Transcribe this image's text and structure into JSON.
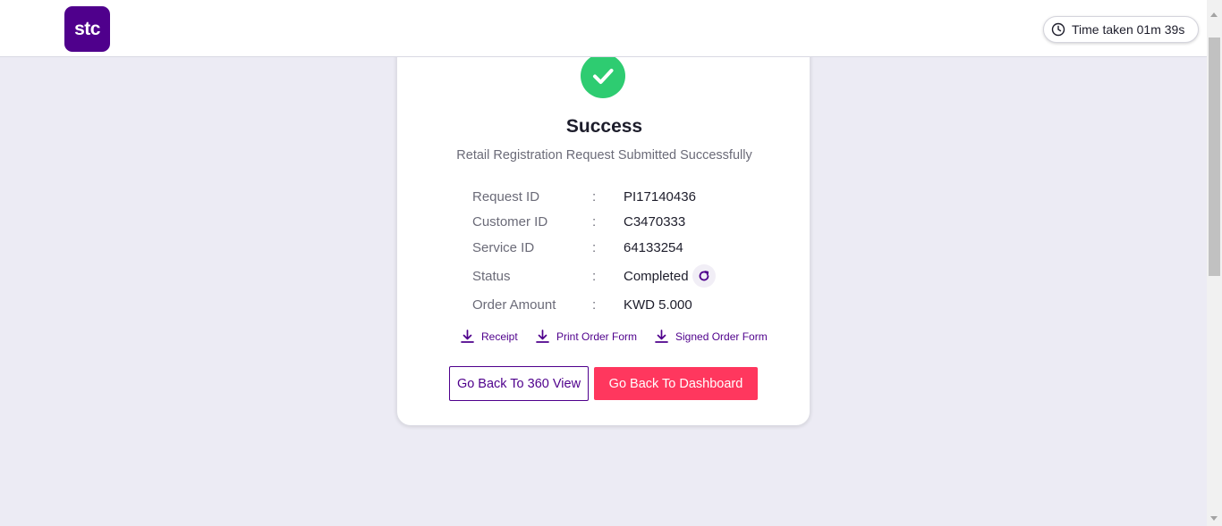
{
  "header": {
    "logo_text": "stc",
    "timer_label": "Time taken 01m 39s"
  },
  "card": {
    "title": "Success",
    "subtitle": "Retail Registration Request Submitted Successfully",
    "details": [
      {
        "label": "Request ID",
        "separator": ":",
        "value": "PI17140436"
      },
      {
        "label": "Customer ID",
        "separator": ":",
        "value": "C3470333"
      },
      {
        "label": "Service ID",
        "separator": ":",
        "value": "64133254"
      },
      {
        "label": "Status",
        "separator": ":",
        "value": "Completed"
      },
      {
        "label": "Order Amount",
        "separator": ":",
        "value": "KWD 5.000"
      }
    ],
    "links": [
      {
        "label": "Receipt",
        "icon": "download-icon"
      },
      {
        "label": "Print Order Form",
        "icon": "download-icon"
      },
      {
        "label": "Signed Order Form",
        "icon": "download-icon"
      }
    ],
    "buttons": {
      "back_360": "Go Back To 360 View",
      "back_dashboard": "Go Back To Dashboard"
    }
  },
  "colors": {
    "brand_purple": "#4f008c",
    "accent_pink": "#ff375e",
    "success_green": "#2ecc71",
    "page_background": "#ecebf4"
  }
}
